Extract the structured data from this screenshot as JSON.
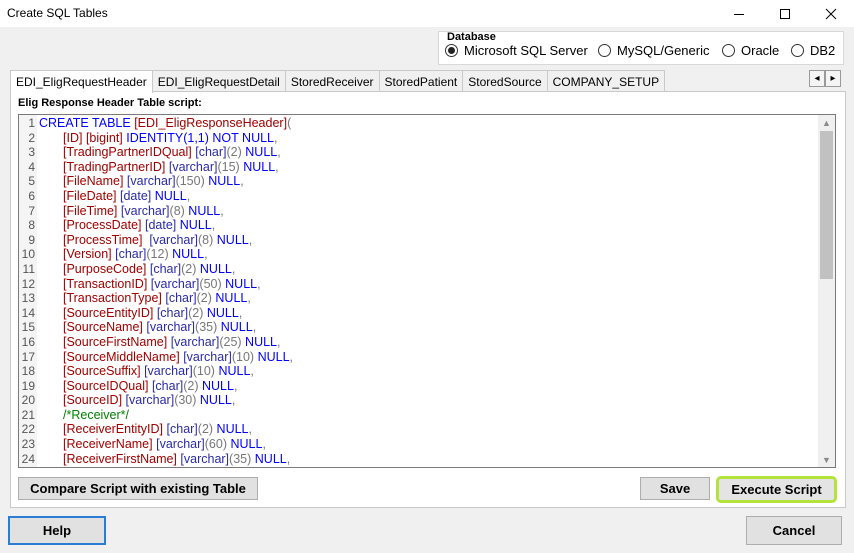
{
  "window": {
    "title": "Create SQL Tables",
    "controls": {
      "minimize": "minimize-icon",
      "maximize": "maximize-icon",
      "close": "close-icon"
    }
  },
  "database": {
    "label": "Database",
    "options": [
      "Microsoft SQL Server",
      "MySQL/Generic",
      "Oracle",
      "DB2"
    ],
    "selected": "Microsoft SQL Server"
  },
  "tabs": {
    "items": [
      "EDI_EligRequestHeader",
      "EDI_EligRequestDetail",
      "StoredReceiver",
      "StoredPatient",
      "StoredSource",
      "COMPANY_SETUP"
    ],
    "active": "EDI_EligRequestHeader",
    "scroll": {
      "left": "◂",
      "right": "▸"
    }
  },
  "script": {
    "label": "Elig Response Header Table script:",
    "lines": [
      "1",
      "2",
      "3",
      "4",
      "5",
      "6",
      "7",
      "8",
      "9",
      "10",
      "11",
      "12",
      "13",
      "14",
      "15",
      "16",
      "17",
      "18",
      "19",
      "20",
      "21",
      "22",
      "23",
      "24"
    ],
    "code": {
      "l1": {
        "create": "CREATE TABLE",
        "name": "[EDI_EligResponseHeader]",
        "paren": "("
      },
      "l2": {
        "col": "[ID]",
        "type": "[bigint]",
        "mod": "IDENTITY(1,1)",
        "null": "NOT NULL",
        "end": ","
      },
      "l3": {
        "col": "[TradingPartnerIDQual]",
        "type": "[char]",
        "size": "(2)",
        "null": "NULL",
        "end": ","
      },
      "l4": {
        "col": "[TradingPartnerID]",
        "type": "[varchar]",
        "size": "(15)",
        "null": "NULL",
        "end": ","
      },
      "l5": {
        "col": "[FileName]",
        "type": "[varchar]",
        "size": "(150)",
        "null": "NULL",
        "end": ","
      },
      "l6": {
        "col": "[FileDate]",
        "type": "[date]",
        "null": "NULL",
        "end": ","
      },
      "l7": {
        "col": "[FileTime]",
        "type": "[varchar]",
        "size": "(8)",
        "null": "NULL",
        "end": ","
      },
      "l8": {
        "col": "[ProcessDate]",
        "type": "[date]",
        "null": "NULL",
        "end": ","
      },
      "l9": {
        "col": "[ProcessTime]",
        "type": "[varchar]",
        "size": "(8)",
        "null": "NULL",
        "end": ","
      },
      "l10": {
        "col": "[Version]",
        "type": "[char]",
        "size": "(12)",
        "null": "NULL",
        "end": ","
      },
      "l11": {
        "col": "[PurposeCode]",
        "type": "[char]",
        "size": "(2)",
        "null": "NULL",
        "end": ","
      },
      "l12": {
        "col": "[TransactionID]",
        "type": "[varchar]",
        "size": "(50)",
        "null": "NULL",
        "end": ","
      },
      "l13": {
        "col": "[TransactionType]",
        "type": "[char]",
        "size": "(2)",
        "null": "NULL",
        "end": ","
      },
      "l14": {
        "col": "[SourceEntityID]",
        "type": "[char]",
        "size": "(2)",
        "null": "NULL",
        "end": ","
      },
      "l15": {
        "col": "[SourceName]",
        "type": "[varchar]",
        "size": "(35)",
        "null": "NULL",
        "end": ","
      },
      "l16": {
        "col": "[SourceFirstName]",
        "type": "[varchar]",
        "size": "(25)",
        "null": "NULL",
        "end": ","
      },
      "l17": {
        "col": "[SourceMiddleName]",
        "type": "[varchar]",
        "size": "(10)",
        "null": "NULL",
        "end": ","
      },
      "l18": {
        "col": "[SourceSuffix]",
        "type": "[varchar]",
        "size": "(10)",
        "null": "NULL",
        "end": ","
      },
      "l19": {
        "col": "[SourceIDQual]",
        "type": "[char]",
        "size": "(2)",
        "null": "NULL",
        "end": ","
      },
      "l20": {
        "col": "[SourceID]",
        "type": "[varchar]",
        "size": "(30)",
        "null": "NULL",
        "end": ","
      },
      "l21": {
        "comment": "/*Receiver*/"
      },
      "l22": {
        "col": "[ReceiverEntityID]",
        "type": "[char]",
        "size": "(2)",
        "null": "NULL",
        "end": ","
      },
      "l23": {
        "col": "[ReceiverName]",
        "type": "[varchar]",
        "size": "(60)",
        "null": "NULL",
        "end": ","
      },
      "l24": {
        "col": "[ReceiverFirstName]",
        "type": "[varchar]",
        "size": "(35)",
        "null": "NULL",
        "end": ","
      }
    }
  },
  "buttons": {
    "compare": "Compare Script with existing Table",
    "save": "Save",
    "execute": "Execute Script",
    "help": "Help",
    "cancel": "Cancel"
  },
  "colors": {
    "execute_highlight": "#b4e33b",
    "help_focus": "#2b7cd3",
    "keyword": "#0000ff",
    "type": "#2a2aa8",
    "identifier": "#a00000",
    "comment": "#008000"
  }
}
